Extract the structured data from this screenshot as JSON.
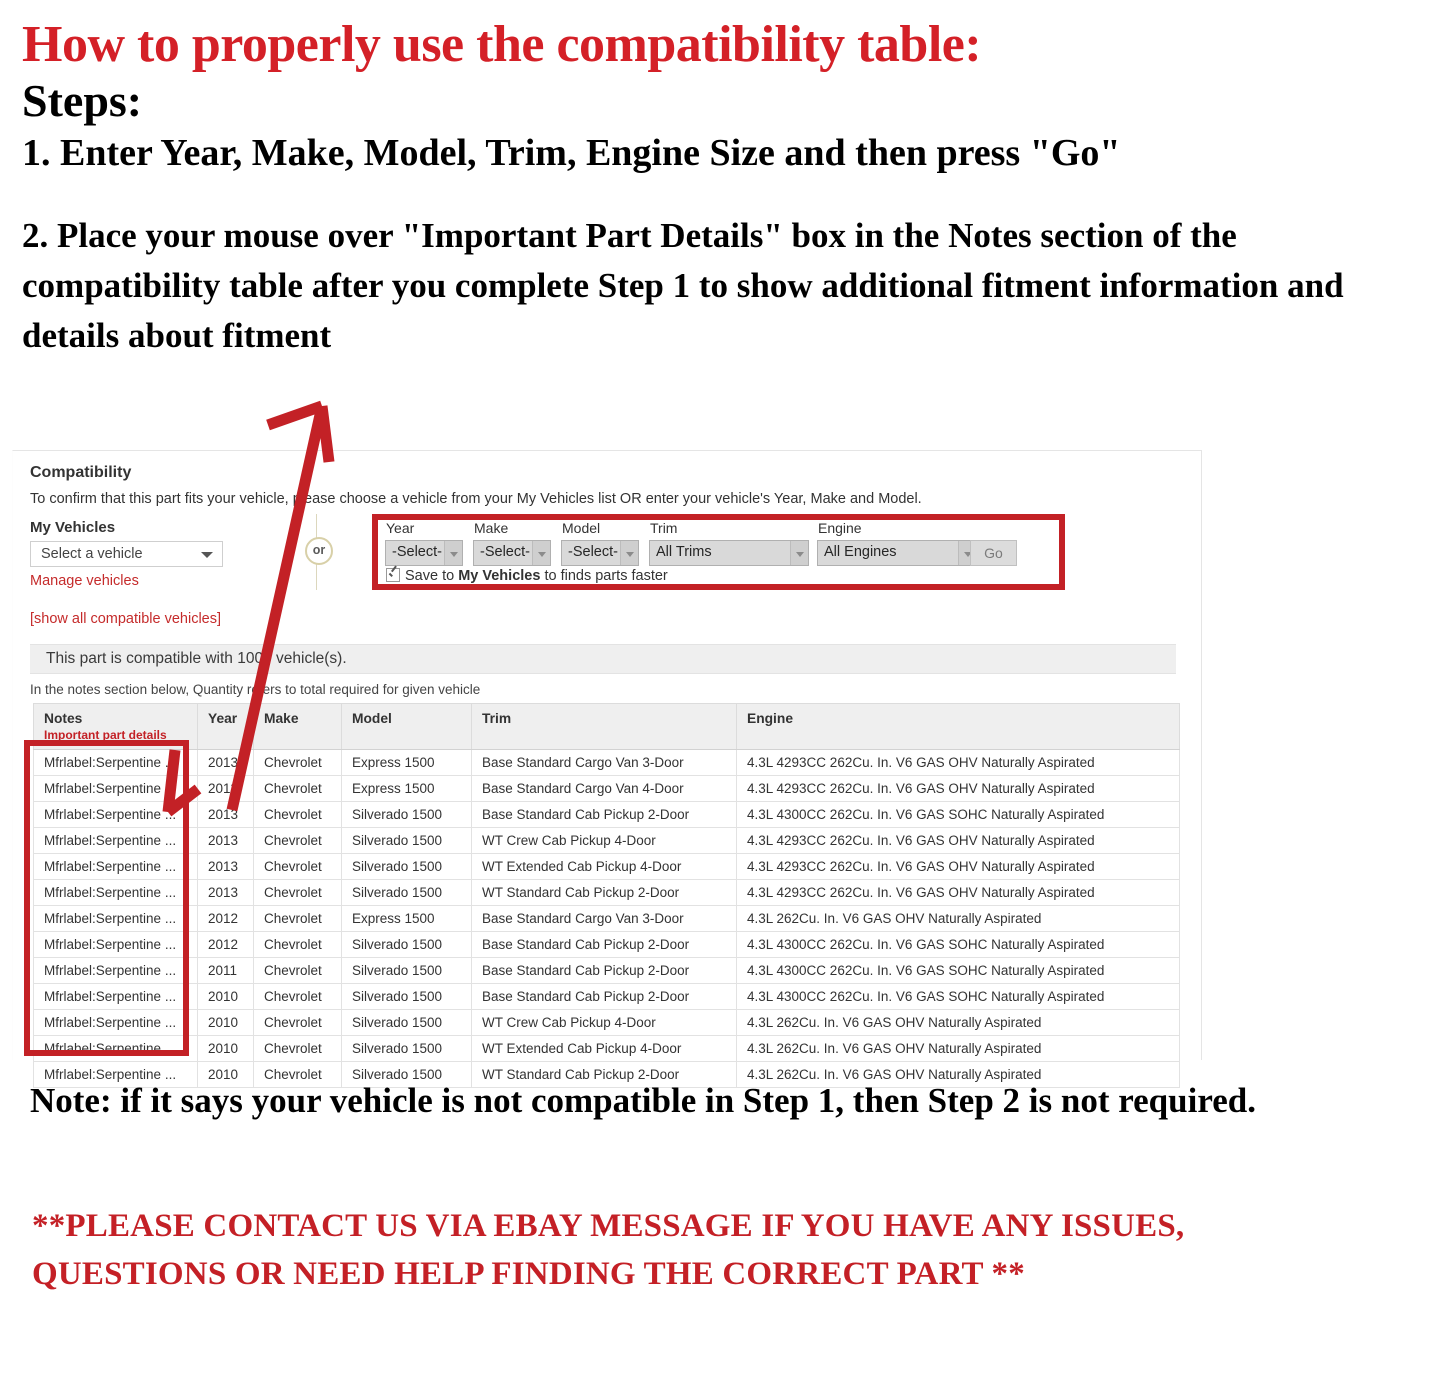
{
  "instructions": {
    "heading": "How to properly use the compatibility table:",
    "steps_label": "Steps:",
    "step1": "1. Enter Year, Make, Model, Trim, Engine Size and then press \"Go\"",
    "step2": "2. Place your mouse over \"Important Part Details\" box in the Notes section of the compatibility table after you complete Step 1 to show additional fitment information and details about fitment",
    "note": "Note: if it says your vehicle is not compatible in Step 1, then Step 2 is not required.",
    "contact": "**PLEASE CONTACT US VIA EBAY MESSAGE IF YOU HAVE ANY ISSUES, QUESTIONS OR NEED HELP FINDING THE CORRECT PART **"
  },
  "colors": {
    "red_heading": "#d42027",
    "red_highlight": "#c32126",
    "link_red": "#c52b2b",
    "or_border": "#d8d0a8",
    "header_gray": "#efefef"
  },
  "panel": {
    "title": "Compatibility",
    "subtitle": "To confirm that this part fits your vehicle, please choose a vehicle from your My Vehicles list OR enter your vehicle's Year, Make and Model.",
    "my_vehicles_label": "My Vehicles",
    "vehicle_select_value": "Select a vehicle",
    "manage_vehicles_link": "Manage vehicles",
    "show_all_link": "[show all compatible vehicles]",
    "or_label": "or",
    "compatible_banner": "This part is compatible with 1000 vehicle(s).",
    "quantity_note": "In the notes section below, Quantity refers to total required for given vehicle"
  },
  "form": {
    "fields": [
      {
        "label": "Year",
        "value": "-Select-"
      },
      {
        "label": "Make",
        "value": "-Select-"
      },
      {
        "label": "Model",
        "value": "-Select-"
      },
      {
        "label": "Trim",
        "value": "All Trims"
      },
      {
        "label": "Engine",
        "value": "All Engines"
      }
    ],
    "go_label": "Go",
    "save_checkbox": {
      "checked": true,
      "prefix": "Save to ",
      "bold": "My Vehicles",
      "suffix": " to finds parts faster"
    }
  },
  "table": {
    "columns": [
      "Notes",
      "Year",
      "Make",
      "Model",
      "Trim",
      "Engine"
    ],
    "notes_subheader": "Important part details",
    "rows": [
      {
        "notes": "Mfrlabel:Serpentine ...",
        "year": "2013",
        "make": "Chevrolet",
        "model": "Express 1500",
        "trim": "Base Standard Cargo Van 3-Door",
        "engine": "4.3L 4293CC 262Cu. In. V6 GAS OHV Naturally Aspirated"
      },
      {
        "notes": "Mfrlabel:Serpentine ...",
        "year": "2013",
        "make": "Chevrolet",
        "model": "Express 1500",
        "trim": "Base Standard Cargo Van 4-Door",
        "engine": "4.3L 4293CC 262Cu. In. V6 GAS OHV Naturally Aspirated"
      },
      {
        "notes": "Mfrlabel:Serpentine ...",
        "year": "2013",
        "make": "Chevrolet",
        "model": "Silverado 1500",
        "trim": "Base Standard Cab Pickup 2-Door",
        "engine": "4.3L 4300CC 262Cu. In. V6 GAS SOHC Naturally Aspirated"
      },
      {
        "notes": "Mfrlabel:Serpentine ...",
        "year": "2013",
        "make": "Chevrolet",
        "model": "Silverado 1500",
        "trim": "WT Crew Cab Pickup 4-Door",
        "engine": "4.3L 4293CC 262Cu. In. V6 GAS OHV Naturally Aspirated"
      },
      {
        "notes": "Mfrlabel:Serpentine ...",
        "year": "2013",
        "make": "Chevrolet",
        "model": "Silverado 1500",
        "trim": "WT Extended Cab Pickup 4-Door",
        "engine": "4.3L 4293CC 262Cu. In. V6 GAS OHV Naturally Aspirated"
      },
      {
        "notes": "Mfrlabel:Serpentine ...",
        "year": "2013",
        "make": "Chevrolet",
        "model": "Silverado 1500",
        "trim": "WT Standard Cab Pickup 2-Door",
        "engine": "4.3L 4293CC 262Cu. In. V6 GAS OHV Naturally Aspirated"
      },
      {
        "notes": "Mfrlabel:Serpentine ...",
        "year": "2012",
        "make": "Chevrolet",
        "model": "Express 1500",
        "trim": "Base Standard Cargo Van 3-Door",
        "engine": "4.3L 262Cu. In. V6 GAS OHV Naturally Aspirated"
      },
      {
        "notes": "Mfrlabel:Serpentine ...",
        "year": "2012",
        "make": "Chevrolet",
        "model": "Silverado 1500",
        "trim": "Base Standard Cab Pickup 2-Door",
        "engine": "4.3L 4300CC 262Cu. In. V6 GAS SOHC Naturally Aspirated"
      },
      {
        "notes": "Mfrlabel:Serpentine ...",
        "year": "2011",
        "make": "Chevrolet",
        "model": "Silverado 1500",
        "trim": "Base Standard Cab Pickup 2-Door",
        "engine": "4.3L 4300CC 262Cu. In. V6 GAS SOHC Naturally Aspirated"
      },
      {
        "notes": "Mfrlabel:Serpentine ...",
        "year": "2010",
        "make": "Chevrolet",
        "model": "Silverado 1500",
        "trim": "Base Standard Cab Pickup 2-Door",
        "engine": "4.3L 4300CC 262Cu. In. V6 GAS SOHC Naturally Aspirated"
      },
      {
        "notes": "Mfrlabel:Serpentine ...",
        "year": "2010",
        "make": "Chevrolet",
        "model": "Silverado 1500",
        "trim": "WT Crew Cab Pickup 4-Door",
        "engine": "4.3L 262Cu. In. V6 GAS OHV Naturally Aspirated"
      },
      {
        "notes": "Mfrlabel:Serpentine ...",
        "year": "2010",
        "make": "Chevrolet",
        "model": "Silverado 1500",
        "trim": "WT Extended Cab Pickup 4-Door",
        "engine": "4.3L 262Cu. In. V6 GAS OHV Naturally Aspirated"
      },
      {
        "notes": "Mfrlabel:Serpentine ...",
        "year": "2010",
        "make": "Chevrolet",
        "model": "Silverado 1500",
        "trim": "WT Standard Cab Pickup 2-Door",
        "engine": "4.3L 262Cu. In. V6 GAS OHV Naturally Aspirated"
      }
    ]
  }
}
